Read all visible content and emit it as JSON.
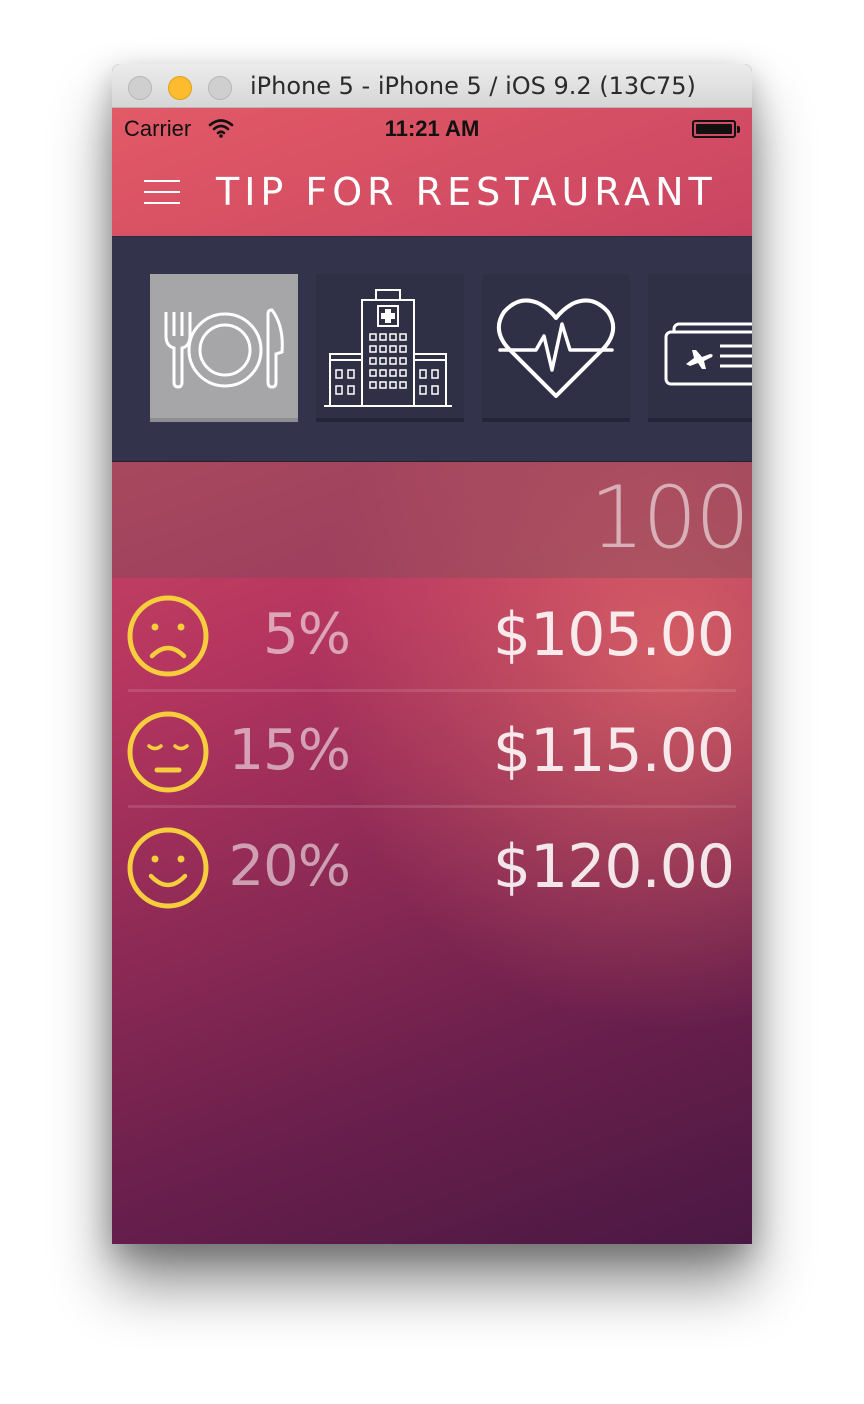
{
  "window": {
    "title": "iPhone 5 - iPhone 5 / iOS 9.2 (13C75)",
    "controls": [
      "close-button",
      "minimize-button",
      "maximize-button"
    ]
  },
  "status_bar": {
    "carrier": "Carrier",
    "time": "11:21 AM",
    "icons": [
      "wifi-icon",
      "battery-icon"
    ]
  },
  "nav": {
    "menu_icon": "hamburger-menu-icon",
    "title": "TIP FOR RESTAURANT"
  },
  "categories": [
    {
      "icon": "restaurant-plate-icon",
      "selected": true
    },
    {
      "icon": "hospital-icon",
      "selected": false
    },
    {
      "icon": "heart-health-icon",
      "selected": false
    },
    {
      "icon": "flight-ticket-icon",
      "selected": false
    }
  ],
  "bill": {
    "amount": "100"
  },
  "tips": [
    {
      "mood": "sad-face-icon",
      "percent": "5%",
      "total": "$105.00"
    },
    {
      "mood": "neutral-face-icon",
      "percent": "15%",
      "total": "$115.00"
    },
    {
      "mood": "smile-face-icon",
      "percent": "20%",
      "total": "$120.00"
    }
  ],
  "colors": {
    "accent_yellow": "#f6cd3d",
    "strip_background": "#33334b",
    "selected_tile": "#a6a6a8",
    "gradient_top": "#e25a66",
    "gradient_bottom": "#4a1844"
  }
}
